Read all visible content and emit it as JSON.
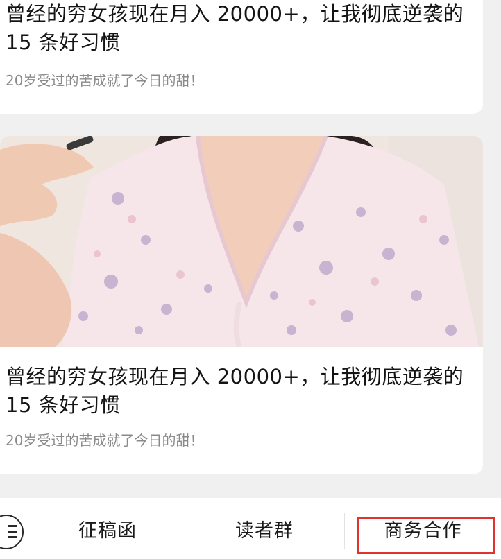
{
  "articles": [
    {
      "title": "曾经的穷女孩现在月入 20000+，让我彻底逆袭的 15 条好习惯",
      "subtitle": "20岁受过的苦成就了今日的甜！"
    },
    {
      "title": "曾经的穷女孩现在月入 20000+，让我彻底逆袭的 15 条好习惯",
      "subtitle": "20岁受过的苦成就了今日的甜！"
    }
  ],
  "bottom_menu": {
    "items": [
      {
        "label": "征稿函"
      },
      {
        "label": "读者群"
      },
      {
        "label": "商务合作"
      }
    ],
    "highlight_color": "#e0322f"
  },
  "icons": [
    "menu-icon"
  ]
}
